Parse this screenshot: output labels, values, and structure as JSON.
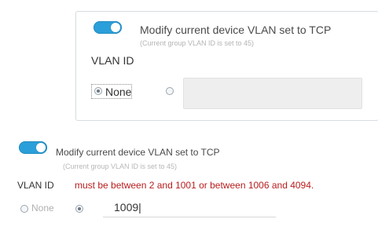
{
  "top_panel": {
    "title": "Modify current device VLAN set to TCP",
    "subtitle": "(Current group VLAN ID is set to 45)",
    "vlan_label": "VLAN ID",
    "none_label": "None",
    "selected_option": "None",
    "input_value": ""
  },
  "bottom_panel": {
    "title": "Modify current device VLAN set to TCP",
    "subtitle": "(Current group VLAN ID is set to 45)",
    "vlan_label": "VLAN ID",
    "error_text": "must be between 2 and 1001 or between 1006 and 4094.",
    "none_label": "None",
    "selected_option": "custom",
    "input_value": "1009|"
  },
  "colors": {
    "toggle_on": "#2b9fd9",
    "error": "#b81d1d"
  },
  "icons": {
    "toggle": "toggle-icon",
    "radio": "radio-icon"
  }
}
